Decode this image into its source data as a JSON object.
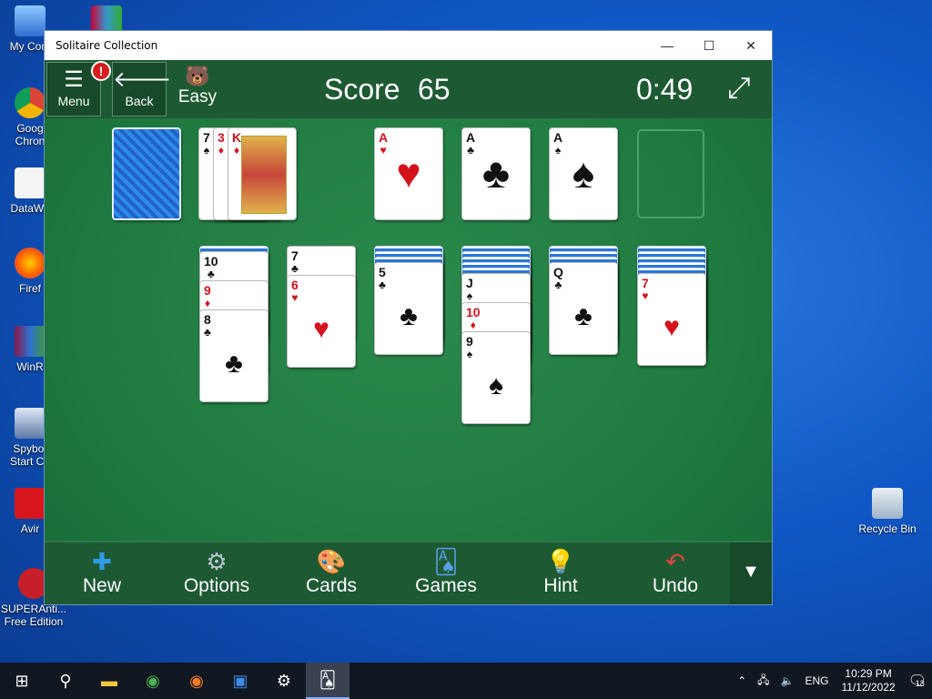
{
  "desktop": {
    "icons": [
      {
        "label": "My Com",
        "icon": "computer-icon"
      },
      {
        "label": "Goog\nChron",
        "icon": "chrome-icon"
      },
      {
        "label": "DataWa",
        "icon": "file-icon"
      },
      {
        "label": "Firef",
        "icon": "firefox-icon"
      },
      {
        "label": "WinR",
        "icon": "winrar-icon"
      },
      {
        "label": "Spybot\nStart Ce",
        "icon": "spybot-icon"
      },
      {
        "label": "Avir",
        "icon": "avira-icon"
      },
      {
        "label": "SUPERAnti...\nFree Edition",
        "icon": "superantispyware-icon"
      },
      {
        "label": "Recycle Bin",
        "icon": "recycle-bin-icon"
      }
    ]
  },
  "window": {
    "title": "Solitaire Collection",
    "controls": {
      "minimize": "—",
      "maximize": "☐",
      "close": "✕"
    }
  },
  "game": {
    "menu_label": "Menu",
    "menu_alert": "!",
    "back_label": "Back",
    "difficulty": "Easy",
    "score_label": "Score",
    "score": "65",
    "time": "0:49"
  },
  "stock_top": {
    "card": "back"
  },
  "waste": [
    {
      "rank": "7",
      "suit": "♠",
      "color": "black"
    },
    {
      "rank": "3",
      "suit": "♦",
      "color": "red"
    },
    {
      "rank": "K",
      "suit": "♦",
      "color": "red"
    }
  ],
  "foundations": [
    {
      "rank": "A",
      "suit": "♥",
      "color": "red"
    },
    {
      "rank": "A",
      "suit": "♣",
      "color": "black"
    },
    {
      "rank": "A",
      "suit": "♠",
      "color": "black"
    },
    {
      "rank": "",
      "suit": "",
      "color": "empty"
    }
  ],
  "tableau": [
    {
      "face_down": 1,
      "cards": [
        {
          "rank": "10",
          "suit": "♣",
          "color": "black"
        },
        {
          "rank": "9",
          "suit": "♦",
          "color": "red"
        },
        {
          "rank": "8",
          "suit": "♣",
          "color": "black"
        }
      ]
    },
    {
      "face_down": 0,
      "cards": [
        {
          "rank": "7",
          "suit": "♣",
          "color": "black"
        },
        {
          "rank": "6",
          "suit": "♥",
          "color": "red"
        }
      ]
    },
    {
      "face_down": 3,
      "cards": [
        {
          "rank": "5",
          "suit": "♣",
          "color": "black"
        }
      ]
    },
    {
      "face_down": 5,
      "cards": [
        {
          "rank": "J",
          "suit": "♠",
          "color": "black"
        },
        {
          "rank": "10",
          "suit": "♦",
          "color": "red"
        },
        {
          "rank": "9",
          "suit": "♠",
          "color": "black"
        }
      ]
    },
    {
      "face_down": 3,
      "cards": [
        {
          "rank": "Q",
          "suit": "♣",
          "color": "black"
        }
      ]
    },
    {
      "face_down": 5,
      "cards": [
        {
          "rank": "7",
          "suit": "♥",
          "color": "red"
        }
      ]
    }
  ],
  "toolbar": {
    "new": "New",
    "options": "Options",
    "cards": "Cards",
    "games": "Games",
    "hint": "Hint",
    "undo": "Undo"
  },
  "taskbar": {
    "language": "ENG",
    "time": "10:29 PM",
    "date": "11/12/2022",
    "notifications": "13"
  }
}
